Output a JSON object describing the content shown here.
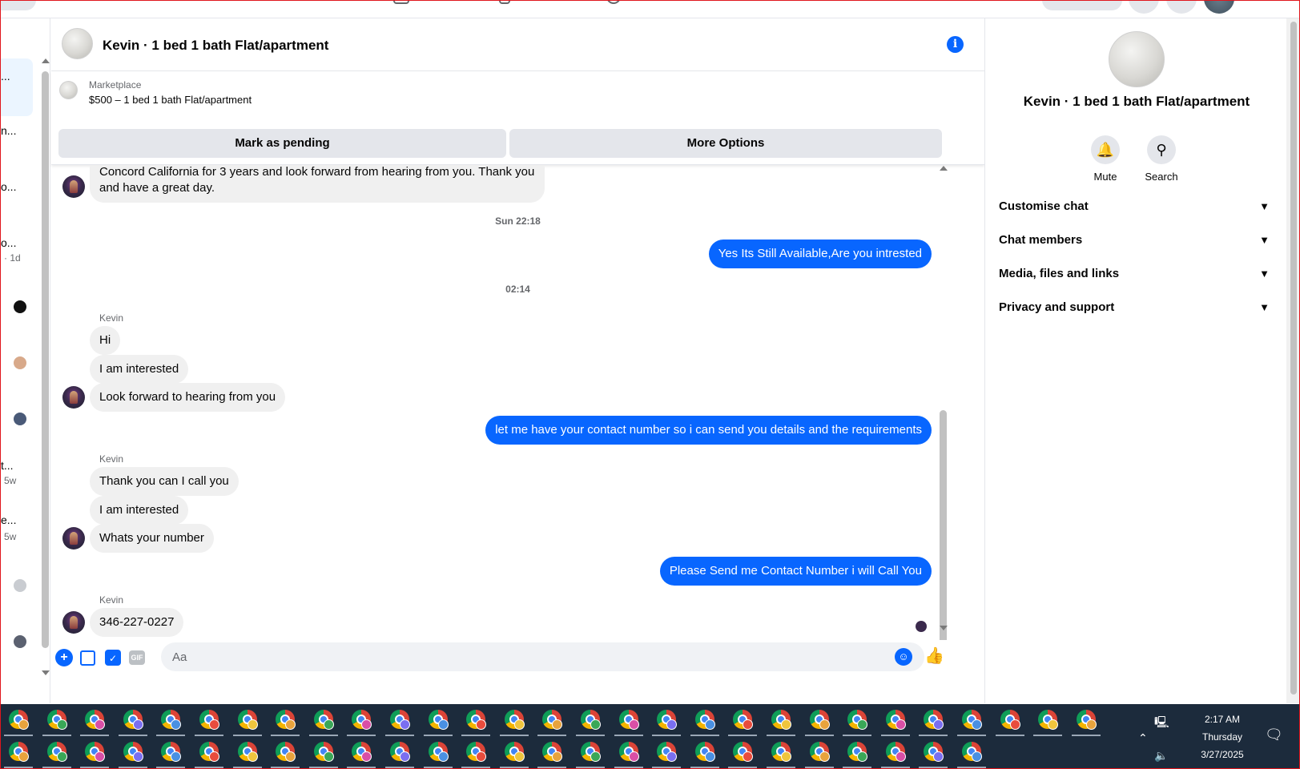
{
  "left_list": {
    "items": [
      {
        "text": "...",
        "meta": ""
      },
      {
        "text": "n...",
        "meta": ""
      },
      {
        "text": "o...",
        "meta": ""
      },
      {
        "text": "o...",
        "meta": "· 1d"
      },
      {
        "text": "t...",
        "meta": "5w"
      },
      {
        "text": "e...",
        "meta": "5w"
      }
    ]
  },
  "header": {
    "title": "Kevin · 1 bed 1 bath Flat/apartment",
    "info_icon": "info-icon"
  },
  "marketplace": {
    "label": "Marketplace",
    "listing": "$500 – 1 bed 1 bath Flat/apartment",
    "mark_pending_label": "Mark as pending",
    "more_options_label": "More Options"
  },
  "messages": {
    "top_partial": {
      "line1": "Concord California for 3 years and look forward from hearing from you. Thank you",
      "line2": "and have a great day."
    },
    "ts1": "Sun 22:18",
    "out1": "Yes Its Still Available,Are you intrested",
    "ts2": "02:14",
    "group1": {
      "sender": "Kevin",
      "m1": "Hi",
      "m2": "I am interested",
      "m3": "Look forward to hearing from you"
    },
    "out2": "let me have your contact number so i can send you details and the requirements",
    "group2": {
      "sender": "Kevin",
      "m1": "Thank you can I call you",
      "m2": "I am interested",
      "m3": "Whats your number"
    },
    "out3": "Please Send me Contact Number i will Call You",
    "group3": {
      "sender": "Kevin",
      "m1": "346-227-0227"
    }
  },
  "composer": {
    "placeholder": "Aa"
  },
  "right_panel": {
    "title": "Kevin · 1 bed 1 bath Flat/apartment",
    "mute_label": "Mute",
    "search_label": "Search",
    "sections": [
      "Customise chat",
      "Chat members",
      "Media, files and links",
      "Privacy and support"
    ]
  },
  "taskbar": {
    "time": "2:17 AM",
    "day": "Thursday",
    "date": "3/27/2025",
    "row1_count": 29,
    "row2_count": 26,
    "profile_colors": [
      "#e8a33d",
      "#3aa757",
      "#d94fa6",
      "#7a6ff0",
      "#4a90e2",
      "#e84c3d",
      "#f0c53d"
    ]
  },
  "colors": {
    "accent": "#0866ff",
    "bubble_in": "#f0f0f0",
    "taskbar": "#1c2b3c"
  }
}
